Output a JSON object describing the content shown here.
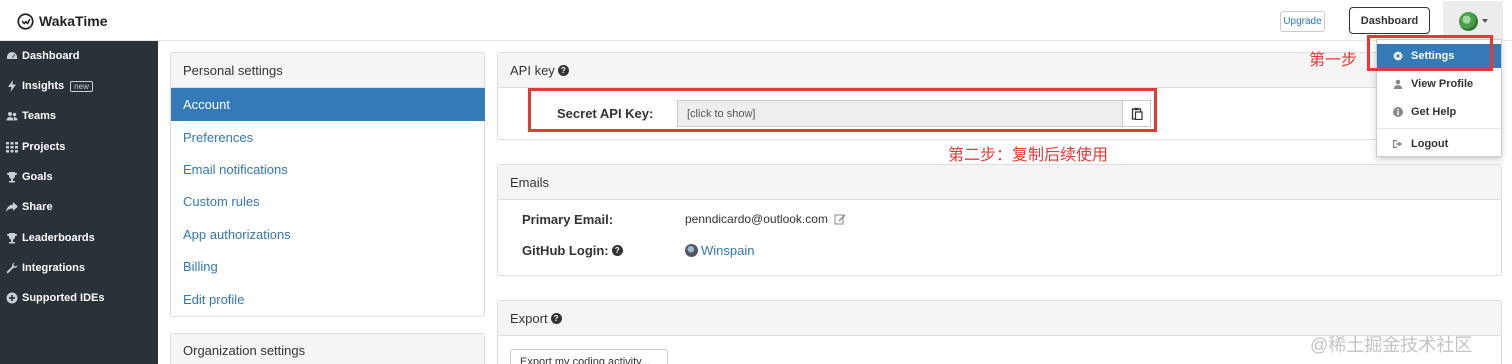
{
  "app": {
    "name": "WakaTime"
  },
  "header": {
    "upgrade_label": "Upgrade",
    "dashboard_label": "Dashboard"
  },
  "sidebar": {
    "items": [
      {
        "label": "Dashboard",
        "icon": "dashboard-icon"
      },
      {
        "label": "Insights",
        "icon": "bolt-icon",
        "badge": "new"
      },
      {
        "label": "Teams",
        "icon": "users-icon"
      },
      {
        "label": "Projects",
        "icon": "grid-icon"
      },
      {
        "label": "Goals",
        "icon": "trophy-icon"
      },
      {
        "label": "Share",
        "icon": "share-icon"
      },
      {
        "label": "Leaderboards",
        "icon": "trophy-icon"
      },
      {
        "label": "Integrations",
        "icon": "wrench-icon"
      },
      {
        "label": "Supported IDEs",
        "icon": "plus-circle-icon"
      }
    ]
  },
  "personal_settings": {
    "heading": "Personal settings",
    "items": [
      "Account",
      "Preferences",
      "Email notifications",
      "Custom rules",
      "App authorizations",
      "Billing",
      "Edit profile"
    ],
    "active_index": 0
  },
  "organization_settings": {
    "heading": "Organization settings"
  },
  "api_key": {
    "heading": "API key",
    "label": "Secret API Key:",
    "value": "[click to show]"
  },
  "emails": {
    "heading": "Emails",
    "primary_label": "Primary Email:",
    "primary_value": "penndicardo@outlook.com",
    "github_label": "GitHub Login:",
    "github_value": "Winspain"
  },
  "export": {
    "heading": "Export",
    "button_label": "Export my coding activity..."
  },
  "dropdown": {
    "items": [
      "Settings",
      "View Profile",
      "Get Help",
      "Logout"
    ]
  },
  "annotations": {
    "step1": "第一步",
    "step2": "第二步：复制后续使用",
    "color": "#e53935"
  },
  "watermark": "@稀土掘金技术社区",
  "colors": {
    "sidebar_bg": "#283238",
    "accent": "#337ab7",
    "link": "#3278b5"
  }
}
